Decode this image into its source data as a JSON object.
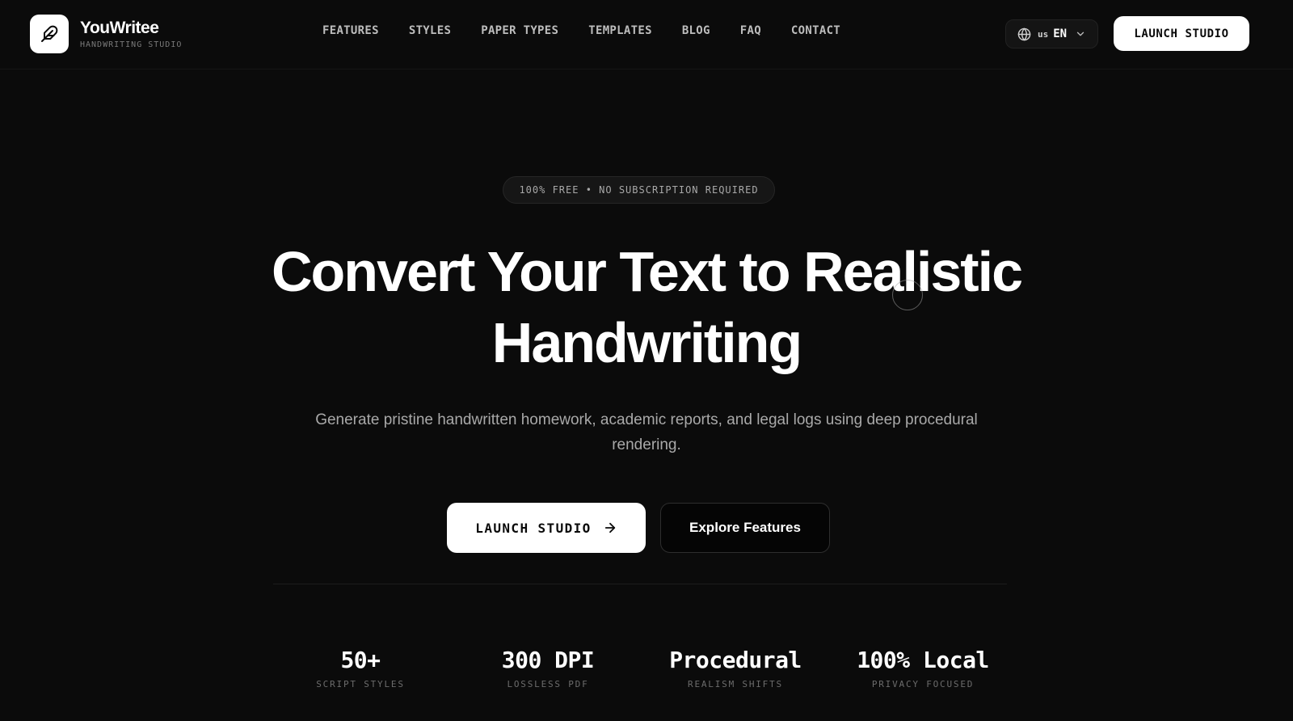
{
  "brand": {
    "name": "YouWritee",
    "tagline": "HANDWRITING STUDIO",
    "logo_icon": "feather-icon"
  },
  "nav": {
    "items": [
      {
        "label": "FEATURES"
      },
      {
        "label": "STYLES"
      },
      {
        "label": "PAPER TYPES"
      },
      {
        "label": "TEMPLATES"
      },
      {
        "label": "BLOG"
      },
      {
        "label": "FAQ"
      },
      {
        "label": "CONTACT"
      }
    ]
  },
  "language": {
    "icon": "globe-icon",
    "flag": "us",
    "code": "EN",
    "dropdown_icon": "chevron-down-icon"
  },
  "header": {
    "cta_label": "LAUNCH STUDIO"
  },
  "hero": {
    "badge": "100% FREE • NO SUBSCRIPTION REQUIRED",
    "title_line1": "Convert Your Text to Realistic",
    "title_line2": "Handwriting",
    "subtitle": "Generate pristine handwritten homework, academic reports, and legal logs using deep procedural rendering.",
    "primary_cta": "LAUNCH STUDIO",
    "primary_cta_icon": "arrow-right-icon",
    "secondary_cta": "Explore Features"
  },
  "stats": [
    {
      "value": "50+",
      "label": "SCRIPT STYLES"
    },
    {
      "value": "300 DPI",
      "label": "LOSSLESS PDF"
    },
    {
      "value": "Procedural",
      "label": "REALISM SHIFTS"
    },
    {
      "value": "100% Local",
      "label": "PRIVACY FOCUSED"
    }
  ],
  "colors": {
    "background": "#0b0b0b",
    "primary_button": "#ffffff",
    "text_muted": "#a9a9a9"
  }
}
